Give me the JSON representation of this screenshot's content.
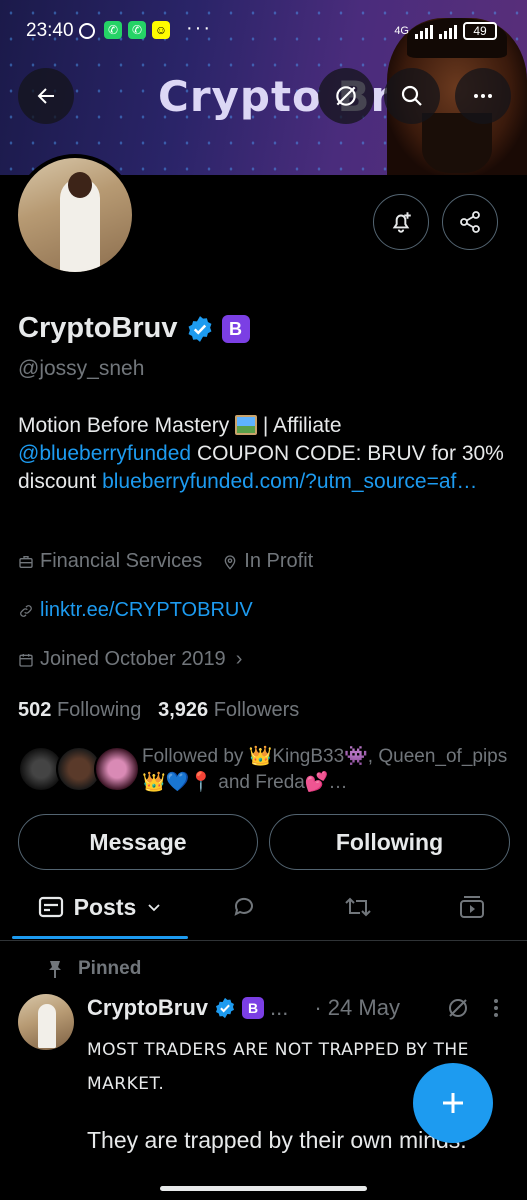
{
  "status_bar": {
    "time": "23:40",
    "network": "4G",
    "battery": "49"
  },
  "banner": {
    "title": "Crypto Bruv"
  },
  "header_actions": {
    "back_icon": "arrow-left-icon",
    "grok_icon": "grok-icon",
    "search_icon": "search-icon",
    "more_icon": "more-horizontal-icon"
  },
  "profile": {
    "display_name": "CryptoBruv",
    "badge_letter": "B",
    "handle": "@jossy_sneh",
    "bio": {
      "part1": "Motion Before Mastery ",
      "part2": " | Affiliate ",
      "mention": "@blueberryfunded",
      "part3": " COUPON CODE: BRUV for 30% discount ",
      "url": "blueberryfunded.com/?utm_source=af…"
    },
    "category": "Financial Services",
    "location": "In Profit",
    "website": "linktr.ee/CRYPTOBRUV",
    "joined": "Joined October 2019",
    "following_count": "502",
    "following_label": "Following",
    "followers_count": "3,926",
    "followers_label": "Followers",
    "followed_by": "Followed by 👑KingB33👾, Queen_of_pips👑💙📍 and Freda💕…"
  },
  "buttons": {
    "message": "Message",
    "following": "Following"
  },
  "tabs": {
    "posts": "Posts",
    "replies_icon": "reply-bubble-icon",
    "reposts_icon": "repost-icon",
    "media_icon": "media-icon"
  },
  "post": {
    "pinned_label": "Pinned",
    "author": "CryptoBruv",
    "badge_letter": "B",
    "ellipsis": "...",
    "date": "· 24 May",
    "caps_text": "MOST TRADERS ARE NOT TRAPPED BY THE MARKET.",
    "body": "They are trapped by their own minds."
  },
  "colors": {
    "accent": "#1d9bf0",
    "background": "#000000",
    "muted_text": "#71767b",
    "badge_purple": "#7b3fe4"
  }
}
